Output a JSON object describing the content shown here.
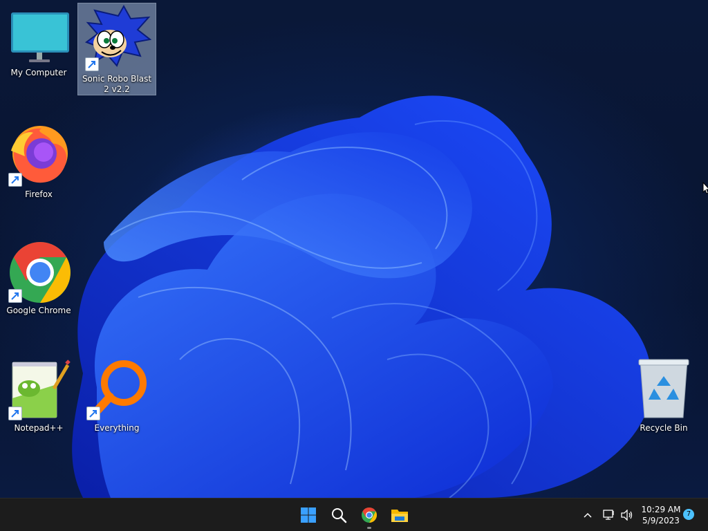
{
  "desktop": {
    "icons": [
      {
        "name": "my-computer",
        "label": "My Computer",
        "shortcut": false
      },
      {
        "name": "sonic-robo-blast-2",
        "label": "Sonic Robo Blast 2 v2.2",
        "shortcut": true,
        "selected": true
      },
      {
        "name": "firefox",
        "label": "Firefox",
        "shortcut": true
      },
      {
        "name": "google-chrome",
        "label": "Google Chrome",
        "shortcut": true
      },
      {
        "name": "notepad-plus-plus",
        "label": "Notepad++",
        "shortcut": true
      },
      {
        "name": "everything",
        "label": "Everything",
        "shortcut": true
      },
      {
        "name": "recycle-bin",
        "label": "Recycle Bin",
        "shortcut": false
      }
    ],
    "wallpaper": "windows-11-bloom-blue"
  },
  "taskbar": {
    "pinned": [
      {
        "name": "start-icon"
      },
      {
        "name": "search-icon"
      },
      {
        "name": "chrome-icon",
        "running": true
      },
      {
        "name": "file-explorer-icon"
      }
    ],
    "tray": {
      "overflow_icon": "chevron-up-icon",
      "network_icon": "network-icon",
      "volume_icon": "volume-icon"
    },
    "clock": {
      "time": "10:29 AM",
      "date": "5/9/2023"
    },
    "notification_count": "7"
  },
  "colors": {
    "taskbar_bg": "#1c1c1c",
    "accent": "#4cc2ff",
    "wallpaper_blue": "#1f4bff"
  }
}
